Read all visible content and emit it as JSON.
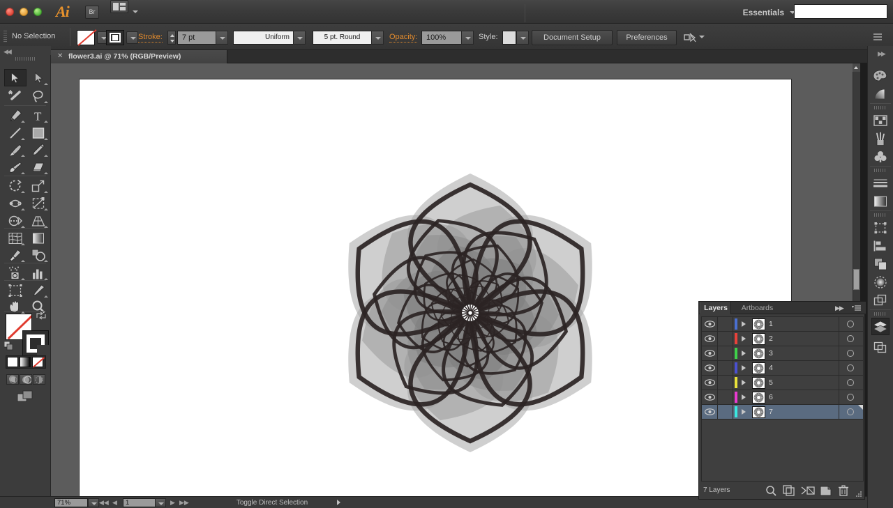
{
  "app": {
    "logo": "Ai",
    "bridge_label": "Br",
    "workspace": "Essentials",
    "arrange_icon": "arrange-documents-icon",
    "search_placeholder": ""
  },
  "control_bar": {
    "selection_status": "No Selection",
    "fill_swatch": "none-fill-swatch",
    "stroke_swatch": "stroke-swatch",
    "stroke_label": "Stroke:",
    "stroke_weight": "7 pt",
    "stroke_profile": "Uniform",
    "brush_definition": "5 pt. Round",
    "opacity_label": "Opacity:",
    "opacity_value": "100%",
    "style_label": "Style:",
    "document_setup": "Document Setup",
    "preferences": "Preferences",
    "align_icon": "align-to-pixel-grid-icon"
  },
  "document_tab": {
    "title": "flower3.ai @ 71% (RGB/Preview)",
    "close_icon": "close-icon"
  },
  "toolbar": {
    "tools": [
      {
        "name": "selection-tool",
        "selected": true
      },
      {
        "name": "direct-selection-tool",
        "selected": false
      },
      {
        "name": "magic-wand-tool",
        "selected": false
      },
      {
        "name": "lasso-tool",
        "selected": false
      },
      {
        "name": "pen-tool",
        "selected": false
      },
      {
        "name": "type-tool",
        "selected": false
      },
      {
        "name": "line-segment-tool",
        "selected": false
      },
      {
        "name": "rectangle-tool",
        "selected": false
      },
      {
        "name": "paintbrush-tool",
        "selected": false
      },
      {
        "name": "pencil-tool",
        "selected": false
      },
      {
        "name": "blob-brush-tool",
        "selected": false
      },
      {
        "name": "eraser-tool",
        "selected": false
      },
      {
        "name": "rotate-tool",
        "selected": false
      },
      {
        "name": "scale-tool",
        "selected": false
      },
      {
        "name": "width-tool",
        "selected": false
      },
      {
        "name": "free-transform-tool",
        "selected": false
      },
      {
        "name": "shape-builder-tool",
        "selected": false
      },
      {
        "name": "perspective-grid-tool",
        "selected": false
      },
      {
        "name": "mesh-tool",
        "selected": false
      },
      {
        "name": "gradient-tool",
        "selected": false
      },
      {
        "name": "eyedropper-tool",
        "selected": false
      },
      {
        "name": "blend-tool",
        "selected": false
      },
      {
        "name": "symbol-sprayer-tool",
        "selected": false
      },
      {
        "name": "column-graph-tool",
        "selected": false
      },
      {
        "name": "artboard-tool",
        "selected": false
      },
      {
        "name": "slice-tool",
        "selected": false
      },
      {
        "name": "hand-tool",
        "selected": false
      },
      {
        "name": "zoom-tool",
        "selected": false
      }
    ],
    "fill_color": "none",
    "stroke_color": "#2e2e2e",
    "color_modes": [
      "color",
      "gradient",
      "none"
    ],
    "draw_modes": [
      "draw-normal",
      "draw-behind",
      "draw-inside"
    ],
    "screen_mode": "change-screen-mode"
  },
  "canvas": {
    "background": "#5c5c5c",
    "artboard_color": "#ffffff",
    "artwork": {
      "name": "recursive-flower-mandala",
      "symmetry": 6,
      "rings": 7,
      "stroke_color": "#2b2424",
      "palette": [
        "#a8a8a8",
        "#9a9a9a",
        "#8c8c8c",
        "#7e7e7e",
        "#707070",
        "#626262",
        "#545454"
      ]
    }
  },
  "status_bar": {
    "zoom": "71%",
    "page": "1",
    "status_text": "Toggle Direct Selection",
    "nav_first": "◀◀",
    "nav_prev": "◀",
    "nav_next": "▶",
    "nav_last": "▶▶"
  },
  "right_dock": {
    "icons": [
      {
        "name": "color-panel-icon",
        "active": false
      },
      {
        "name": "color-guide-panel-icon",
        "active": false
      },
      {
        "name": "swatches-panel-icon",
        "active": false
      },
      {
        "name": "brushes-panel-icon",
        "active": false
      },
      {
        "name": "symbols-panel-icon",
        "active": false
      },
      {
        "name": "stroke-panel-icon",
        "active": false
      },
      {
        "name": "gradient-panel-icon",
        "active": false
      },
      {
        "name": "transform-panel-icon",
        "active": false
      },
      {
        "name": "align-panel-icon",
        "active": false
      },
      {
        "name": "pathfinder-panel-icon",
        "active": false
      },
      {
        "name": "transparency-panel-icon",
        "active": false
      },
      {
        "name": "appearance-panel-icon",
        "active": false
      },
      {
        "name": "layers-panel-icon",
        "active": true
      },
      {
        "name": "artboards-panel-icon",
        "active": false
      }
    ]
  },
  "layers_panel": {
    "tabs": [
      {
        "label": "Layers",
        "active": true
      },
      {
        "label": "Artboards",
        "active": false
      }
    ],
    "expand_icon": "expand-panel-icon",
    "menu_icon": "panel-menu-icon",
    "layers": [
      {
        "name": "1",
        "color": "#4a6fd0",
        "visible": true,
        "locked": false,
        "selected": false
      },
      {
        "name": "2",
        "color": "#e8413a",
        "visible": true,
        "locked": false,
        "selected": false
      },
      {
        "name": "3",
        "color": "#3fd04a",
        "visible": true,
        "locked": false,
        "selected": false
      },
      {
        "name": "4",
        "color": "#4a50d0",
        "visible": true,
        "locked": false,
        "selected": false
      },
      {
        "name": "5",
        "color": "#e8e13a",
        "visible": true,
        "locked": false,
        "selected": false
      },
      {
        "name": "6",
        "color": "#e83ad0",
        "visible": true,
        "locked": false,
        "selected": false
      },
      {
        "name": "7",
        "color": "#3ae8e0",
        "visible": true,
        "locked": false,
        "selected": true
      }
    ],
    "count_label": "7 Layers",
    "footer_buttons": [
      {
        "name": "locate-object-button",
        "icon": "magnifier-icon"
      },
      {
        "name": "make-sublayer-button",
        "icon": "sublayer-icon"
      },
      {
        "name": "make-clipping-mask-button",
        "icon": "clipping-mask-icon"
      },
      {
        "name": "create-new-layer-button",
        "icon": "new-layer-icon"
      },
      {
        "name": "delete-selection-button",
        "icon": "trash-icon"
      }
    ]
  }
}
